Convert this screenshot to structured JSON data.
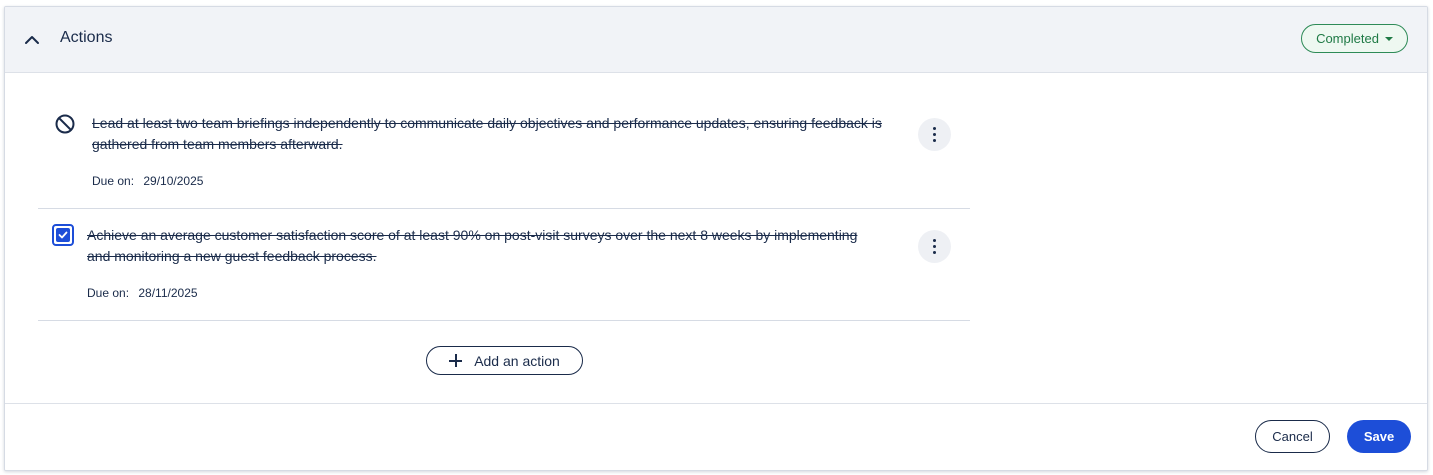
{
  "header": {
    "title": "Actions",
    "collapse_icon": "chevron-up-icon",
    "status": "Completed",
    "status_color": "#1f7a45"
  },
  "actions": [
    {
      "text": "Lead at least two team briefings independently to communicate daily objectives and performance updates, ensuring feedback is gathered from team members afterward.",
      "due_label": "Due on:",
      "due_date": "29/10/2025",
      "state_icon": "blocked-icon",
      "menu_icon": "more-vertical-icon"
    },
    {
      "text": "Achieve an average customer satisfaction score of at least 90% on post-visit surveys over the next 8 weeks by implementing and monitoring a new guest feedback process.",
      "due_label": "Due on:",
      "due_date": "28/11/2025",
      "state_icon": "checkbox-checked-icon",
      "checked": true,
      "menu_icon": "more-vertical-icon"
    }
  ],
  "add_action": {
    "label": "Add an action",
    "icon": "plus-icon"
  },
  "footer": {
    "cancel_label": "Cancel",
    "save_label": "Save",
    "accent_color": "#1d4ed8"
  }
}
